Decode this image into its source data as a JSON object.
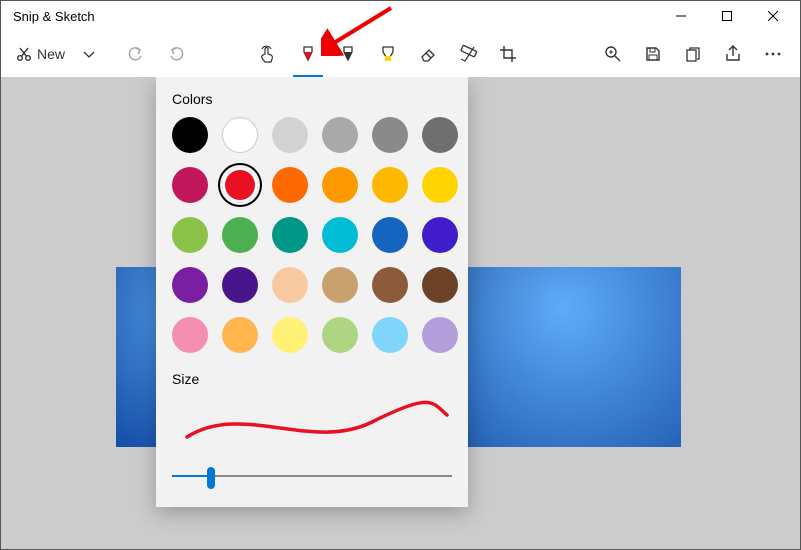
{
  "window": {
    "title": "Snip & Sketch"
  },
  "toolbar": {
    "new_label": "New"
  },
  "popup": {
    "colors_label": "Colors",
    "size_label": "Size",
    "slider_percent": 14,
    "preview_color": "#e81123",
    "colors": [
      {
        "hex": "#000000",
        "selected": false,
        "white": false
      },
      {
        "hex": "#ffffff",
        "selected": false,
        "white": true
      },
      {
        "hex": "#d2d2d2",
        "selected": false,
        "white": false
      },
      {
        "hex": "#a9a9a9",
        "selected": false,
        "white": false
      },
      {
        "hex": "#8a8a8a",
        "selected": false,
        "white": false
      },
      {
        "hex": "#6f6f6f",
        "selected": false,
        "white": false
      },
      {
        "hex": "#c2185b",
        "selected": false,
        "white": false
      },
      {
        "hex": "#e81123",
        "selected": true,
        "white": false
      },
      {
        "hex": "#ff6a00",
        "selected": false,
        "white": false
      },
      {
        "hex": "#ff9900",
        "selected": false,
        "white": false
      },
      {
        "hex": "#ffb800",
        "selected": false,
        "white": false
      },
      {
        "hex": "#ffd400",
        "selected": false,
        "white": false
      },
      {
        "hex": "#8bc34a",
        "selected": false,
        "white": false
      },
      {
        "hex": "#4caf50",
        "selected": false,
        "white": false
      },
      {
        "hex": "#009688",
        "selected": false,
        "white": false
      },
      {
        "hex": "#00bcd4",
        "selected": false,
        "white": false
      },
      {
        "hex": "#1565c0",
        "selected": false,
        "white": false
      },
      {
        "hex": "#3f1dcb",
        "selected": false,
        "white": false
      },
      {
        "hex": "#7b1fa2",
        "selected": false,
        "white": false
      },
      {
        "hex": "#4a148c",
        "selected": false,
        "white": false
      },
      {
        "hex": "#f8c9a0",
        "selected": false,
        "white": false
      },
      {
        "hex": "#c8a16e",
        "selected": false,
        "white": false
      },
      {
        "hex": "#8d5a3b",
        "selected": false,
        "white": false
      },
      {
        "hex": "#6d4126",
        "selected": false,
        "white": false
      },
      {
        "hex": "#f48fb1",
        "selected": false,
        "white": false
      },
      {
        "hex": "#ffb74d",
        "selected": false,
        "white": false
      },
      {
        "hex": "#fff176",
        "selected": false,
        "white": false
      },
      {
        "hex": "#aed581",
        "selected": false,
        "white": false
      },
      {
        "hex": "#81d4fa",
        "selected": false,
        "white": false
      },
      {
        "hex": "#b39ddb",
        "selected": false,
        "white": false
      }
    ]
  }
}
